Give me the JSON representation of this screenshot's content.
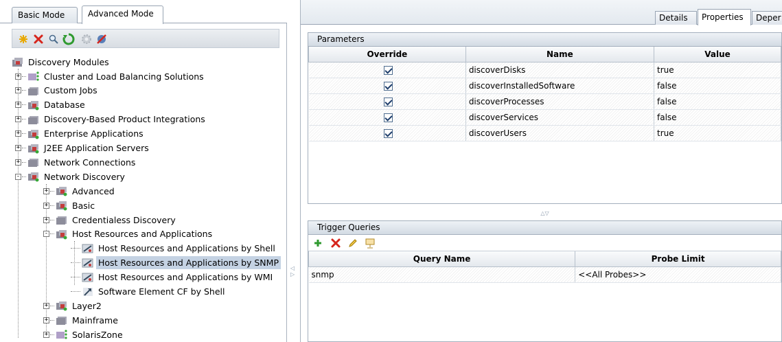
{
  "mode_tabs": [
    "Basic Mode",
    "Advanced Mode"
  ],
  "toolbar_icons": [
    "new-icon",
    "delete-icon",
    "search-icon",
    "refresh-icon",
    "gear-icon",
    "run-icon"
  ],
  "tree": {
    "root": "Discovery Modules",
    "items": [
      {
        "label": "Cluster and Load Balancing Solutions",
        "level": 1,
        "expander": "+"
      },
      {
        "label": "Custom Jobs",
        "level": 1,
        "expander": "+"
      },
      {
        "label": "Database",
        "level": 1,
        "expander": "+"
      },
      {
        "label": "Discovery-Based Product Integrations",
        "level": 1,
        "expander": "+"
      },
      {
        "label": "Enterprise Applications",
        "level": 1,
        "expander": "+"
      },
      {
        "label": "J2EE Application Servers",
        "level": 1,
        "expander": "+"
      },
      {
        "label": "Network Connections",
        "level": 1,
        "expander": "+"
      },
      {
        "label": "Network Discovery",
        "level": 1,
        "expander": "-"
      },
      {
        "label": "Advanced",
        "level": 2,
        "expander": "+"
      },
      {
        "label": "Basic",
        "level": 2,
        "expander": "+"
      },
      {
        "label": "Credentialess Discovery",
        "level": 2,
        "expander": "+"
      },
      {
        "label": "Host Resources and Applications",
        "level": 2,
        "expander": "-"
      },
      {
        "label": "Host Resources and Applications by Shell",
        "level": 3,
        "expander": ""
      },
      {
        "label": "Host Resources and Applications by SNMP",
        "level": 3,
        "expander": "",
        "selected": true
      },
      {
        "label": "Host Resources and Applications by WMI",
        "level": 3,
        "expander": ""
      },
      {
        "label": "Software Element CF by Shell",
        "level": 3,
        "expander": ""
      },
      {
        "label": "Layer2",
        "level": 2,
        "expander": "+"
      },
      {
        "label": "Mainframe",
        "level": 2,
        "expander": "+"
      },
      {
        "label": "SolarisZone",
        "level": 2,
        "expander": "+"
      }
    ]
  },
  "detail_tabs": [
    "Details",
    "Properties",
    "Deper"
  ],
  "parameters": {
    "title": "Parameters",
    "columns": [
      "Override",
      "Name",
      "Value"
    ],
    "rows": [
      {
        "override": true,
        "name": "discoverDisks",
        "value": "true"
      },
      {
        "override": true,
        "name": "discoverInstalledSoftware",
        "value": "false"
      },
      {
        "override": true,
        "name": "discoverProcesses",
        "value": "false"
      },
      {
        "override": true,
        "name": "discoverServices",
        "value": "false"
      },
      {
        "override": true,
        "name": "discoverUsers",
        "value": "true"
      }
    ]
  },
  "trigger_queries": {
    "title": "Trigger Queries",
    "toolbar_icons": [
      "add-icon",
      "delete-icon",
      "edit-icon",
      "presentation-icon"
    ],
    "columns": [
      "Query Name",
      "Probe Limit"
    ],
    "rows": [
      {
        "query_name": "snmp",
        "probe_limit": "<<All Probes>>"
      }
    ]
  },
  "colors": {
    "selection": "#c4d2e3",
    "header_gradient_top": "#eef2f6",
    "delete_red": "#d6251c"
  }
}
